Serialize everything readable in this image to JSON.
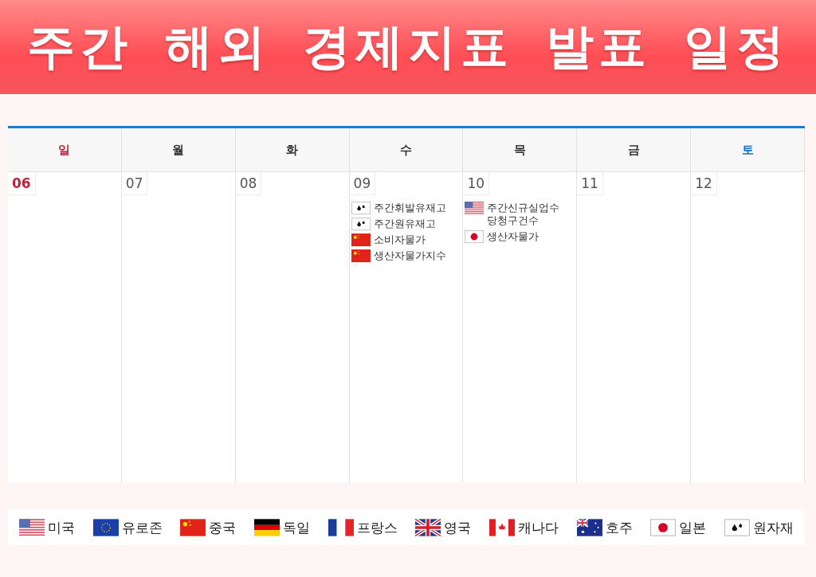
{
  "title": "주간 해외 경제지표 발표 일정",
  "weekdays": [
    {
      "label": "일",
      "color": "#c0223b"
    },
    {
      "label": "월",
      "color": "#333333"
    },
    {
      "label": "화",
      "color": "#333333"
    },
    {
      "label": "수",
      "color": "#333333"
    },
    {
      "label": "목",
      "color": "#333333"
    },
    {
      "label": "금",
      "color": "#333333"
    },
    {
      "label": "토",
      "color": "#1a6fc4"
    }
  ],
  "days": [
    {
      "date": "06",
      "color": "#c0223b"
    },
    {
      "date": "07",
      "color": "#555555"
    },
    {
      "date": "08",
      "color": "#555555"
    },
    {
      "date": "09",
      "color": "#555555",
      "events": [
        {
          "kind": "oil",
          "label": "주간휘발유재고"
        },
        {
          "kind": "oil",
          "label": "주간원유재고"
        },
        {
          "kind": "cn",
          "label": "소비자물가"
        },
        {
          "kind": "cn",
          "label": "생산자물가지수"
        }
      ]
    },
    {
      "date": "10",
      "color": "#555555",
      "events": [
        {
          "kind": "us",
          "label": "주간신규실업수 당청구건수"
        },
        {
          "kind": "jp",
          "label": "생산자물가"
        }
      ]
    },
    {
      "date": "11",
      "color": "#555555"
    },
    {
      "date": "12",
      "color": "#555555"
    }
  ],
  "legend": [
    {
      "kind": "us",
      "label": "미국"
    },
    {
      "kind": "eu",
      "label": "유로존"
    },
    {
      "kind": "cn",
      "label": "중국"
    },
    {
      "kind": "de",
      "label": "독일"
    },
    {
      "kind": "fr",
      "label": "프랑스"
    },
    {
      "kind": "uk",
      "label": "영국"
    },
    {
      "kind": "ca",
      "label": "캐나다"
    },
    {
      "kind": "au",
      "label": "호주"
    },
    {
      "kind": "jp",
      "label": "일본"
    },
    {
      "kind": "oil",
      "label": "원자재"
    }
  ]
}
